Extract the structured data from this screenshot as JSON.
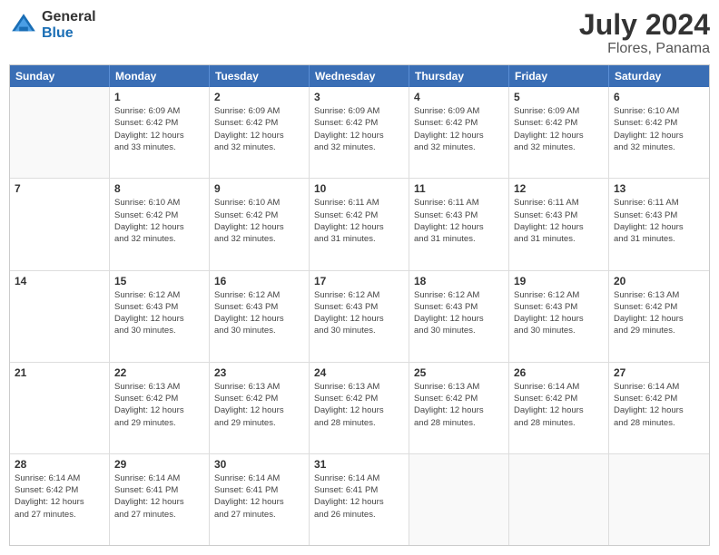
{
  "header": {
    "logo_line1": "General",
    "logo_line2": "Blue",
    "month_year": "July 2024",
    "location": "Flores, Panama"
  },
  "weekdays": [
    "Sunday",
    "Monday",
    "Tuesday",
    "Wednesday",
    "Thursday",
    "Friday",
    "Saturday"
  ],
  "weeks": [
    [
      {
        "day": "",
        "info": ""
      },
      {
        "day": "1",
        "info": "Sunrise: 6:09 AM\nSunset: 6:42 PM\nDaylight: 12 hours\nand 33 minutes."
      },
      {
        "day": "2",
        "info": "Sunrise: 6:09 AM\nSunset: 6:42 PM\nDaylight: 12 hours\nand 32 minutes."
      },
      {
        "day": "3",
        "info": "Sunrise: 6:09 AM\nSunset: 6:42 PM\nDaylight: 12 hours\nand 32 minutes."
      },
      {
        "day": "4",
        "info": "Sunrise: 6:09 AM\nSunset: 6:42 PM\nDaylight: 12 hours\nand 32 minutes."
      },
      {
        "day": "5",
        "info": "Sunrise: 6:09 AM\nSunset: 6:42 PM\nDaylight: 12 hours\nand 32 minutes."
      },
      {
        "day": "6",
        "info": "Sunrise: 6:10 AM\nSunset: 6:42 PM\nDaylight: 12 hours\nand 32 minutes."
      }
    ],
    [
      {
        "day": "7",
        "info": ""
      },
      {
        "day": "8",
        "info": "Sunrise: 6:10 AM\nSunset: 6:42 PM\nDaylight: 12 hours\nand 32 minutes."
      },
      {
        "day": "9",
        "info": "Sunrise: 6:10 AM\nSunset: 6:42 PM\nDaylight: 12 hours\nand 32 minutes."
      },
      {
        "day": "10",
        "info": "Sunrise: 6:11 AM\nSunset: 6:42 PM\nDaylight: 12 hours\nand 31 minutes."
      },
      {
        "day": "11",
        "info": "Sunrise: 6:11 AM\nSunset: 6:43 PM\nDaylight: 12 hours\nand 31 minutes."
      },
      {
        "day": "12",
        "info": "Sunrise: 6:11 AM\nSunset: 6:43 PM\nDaylight: 12 hours\nand 31 minutes."
      },
      {
        "day": "13",
        "info": "Sunrise: 6:11 AM\nSunset: 6:43 PM\nDaylight: 12 hours\nand 31 minutes."
      }
    ],
    [
      {
        "day": "14",
        "info": ""
      },
      {
        "day": "15",
        "info": "Sunrise: 6:12 AM\nSunset: 6:43 PM\nDaylight: 12 hours\nand 30 minutes."
      },
      {
        "day": "16",
        "info": "Sunrise: 6:12 AM\nSunset: 6:43 PM\nDaylight: 12 hours\nand 30 minutes."
      },
      {
        "day": "17",
        "info": "Sunrise: 6:12 AM\nSunset: 6:43 PM\nDaylight: 12 hours\nand 30 minutes."
      },
      {
        "day": "18",
        "info": "Sunrise: 6:12 AM\nSunset: 6:43 PM\nDaylight: 12 hours\nand 30 minutes."
      },
      {
        "day": "19",
        "info": "Sunrise: 6:12 AM\nSunset: 6:43 PM\nDaylight: 12 hours\nand 30 minutes."
      },
      {
        "day": "20",
        "info": "Sunrise: 6:13 AM\nSunset: 6:42 PM\nDaylight: 12 hours\nand 29 minutes."
      }
    ],
    [
      {
        "day": "21",
        "info": ""
      },
      {
        "day": "22",
        "info": "Sunrise: 6:13 AM\nSunset: 6:42 PM\nDaylight: 12 hours\nand 29 minutes."
      },
      {
        "day": "23",
        "info": "Sunrise: 6:13 AM\nSunset: 6:42 PM\nDaylight: 12 hours\nand 29 minutes."
      },
      {
        "day": "24",
        "info": "Sunrise: 6:13 AM\nSunset: 6:42 PM\nDaylight: 12 hours\nand 28 minutes."
      },
      {
        "day": "25",
        "info": "Sunrise: 6:13 AM\nSunset: 6:42 PM\nDaylight: 12 hours\nand 28 minutes."
      },
      {
        "day": "26",
        "info": "Sunrise: 6:14 AM\nSunset: 6:42 PM\nDaylight: 12 hours\nand 28 minutes."
      },
      {
        "day": "27",
        "info": "Sunrise: 6:14 AM\nSunset: 6:42 PM\nDaylight: 12 hours\nand 28 minutes."
      }
    ],
    [
      {
        "day": "28",
        "info": "Sunrise: 6:14 AM\nSunset: 6:42 PM\nDaylight: 12 hours\nand 27 minutes."
      },
      {
        "day": "29",
        "info": "Sunrise: 6:14 AM\nSunset: 6:41 PM\nDaylight: 12 hours\nand 27 minutes."
      },
      {
        "day": "30",
        "info": "Sunrise: 6:14 AM\nSunset: 6:41 PM\nDaylight: 12 hours\nand 27 minutes."
      },
      {
        "day": "31",
        "info": "Sunrise: 6:14 AM\nSunset: 6:41 PM\nDaylight: 12 hours\nand 26 minutes."
      },
      {
        "day": "",
        "info": ""
      },
      {
        "day": "",
        "info": ""
      },
      {
        "day": "",
        "info": ""
      }
    ]
  ]
}
